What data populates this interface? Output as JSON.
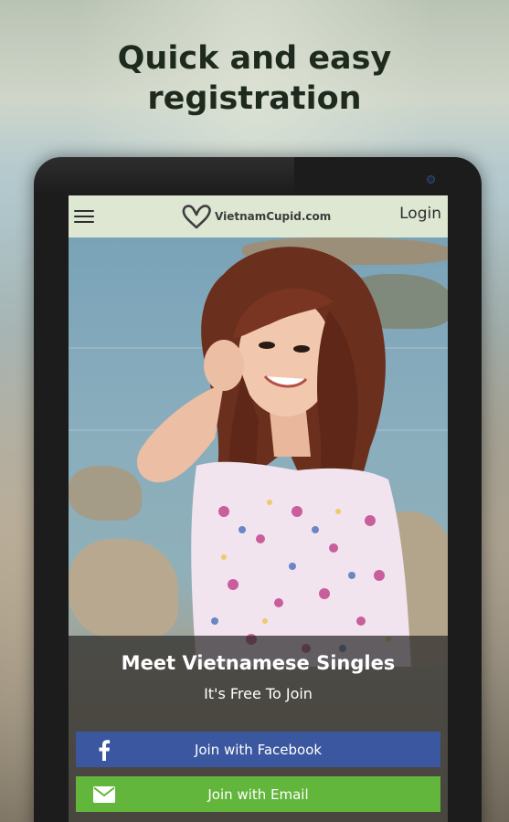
{
  "headline": {
    "line1": "Quick and easy",
    "line2": "registration"
  },
  "app": {
    "logo_text": "VietnamCupid.com",
    "login_label": "Login",
    "tagline": "Meet Vietnamese Singles",
    "subtagline": "It's Free To Join",
    "facebook_button": "Join with Facebook",
    "email_button": "Join with Email"
  },
  "icons": {
    "menu": "hamburger-icon",
    "logo": "heart-logo-icon",
    "facebook": "facebook-icon",
    "email": "envelope-icon"
  },
  "colors": {
    "header_bg": "#dde7d2",
    "facebook_blue": "#3b57a0",
    "email_green": "#62b63b",
    "logo_heart": "#3e3e3e"
  }
}
